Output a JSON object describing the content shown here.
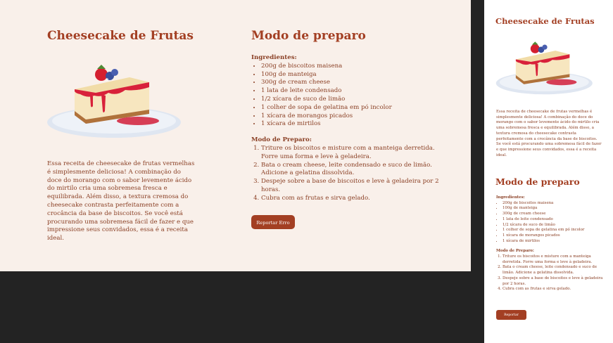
{
  "recipe": {
    "title": "Cheesecake de Frutas",
    "description": "Essa receita de cheesecake de frutas vermelhas é simplesmente deliciosa! A combinação do doce do morango com o sabor levemente ácido do mirtilo cria uma sobremesa fresca e equilibrada. Além disso, a textura cremosa do cheesecake contrasta perfeitamente com a crocância da base de biscoitos. Se você está procurando uma sobremesa fácil de fazer e que impressione seus convidados, essa é a receita ideal.",
    "image_alt": "cheesecake slice with strawberry and blueberries icon"
  },
  "prep": {
    "title": "Modo de preparo",
    "ingredients_label": "Ingredientes:",
    "ingredients": [
      "200g de biscoitos maisena",
      "100g de manteiga",
      "300g de cream cheese",
      "1 lata de leite condensado",
      "1/2 xícara de suco de limão",
      "1 colher de sopa de gelatina em pó incolor",
      "1 xícara de morangos picados",
      "1 xícara de mirtilos"
    ],
    "steps_label": "Modo de Preparo:",
    "steps": [
      "Triture os biscoitos e misture com a manteiga derretida. Forre uma forma e leve à geladeira.",
      "Bata o cream cheese, leite condensado e suco de limão. Adicione a gelatina dissolvida.",
      "Despeje sobre a base de biscoitos e leve à geladeira por 2 horas.",
      "Cubra com as frutas e sirva gelado."
    ],
    "report_button": "Reportar Erro"
  },
  "colors": {
    "accent": "#a33f23",
    "text": "#8a3f24",
    "paper": "#f9f0ea",
    "backdrop": "#232323"
  }
}
